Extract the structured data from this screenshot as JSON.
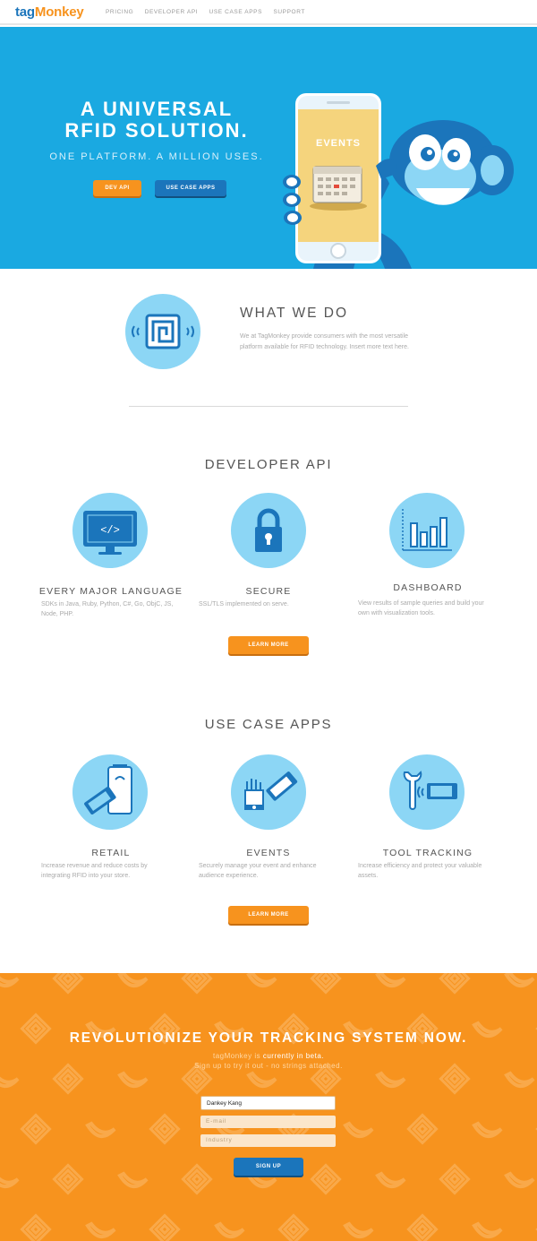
{
  "nav": {
    "logo_tag": "tag",
    "logo_monkey": "Monkey",
    "links": [
      "PRICING",
      "DEVELOPER API",
      "USE CASE APPS",
      "SUPPORT"
    ]
  },
  "hero": {
    "title_line1": "A UNIVERSAL",
    "title_line2": "RFID SOLUTION.",
    "subtitle": "ONE PLATFORM. A MILLION USES.",
    "btn_dev": "DEV API",
    "btn_use_case": "USE CASE APPS",
    "phone_label": "EVENTS"
  },
  "what": {
    "title": "WHAT WE DO",
    "description": "We at TagMonkey provide consumers with the most versatile platform available for RFID technology. Insert more text here."
  },
  "developer": {
    "title": "DEVELOPER API",
    "features": [
      {
        "title": "EVERY MAJOR LANGUAGE",
        "desc": "SDKs in Java, Ruby, Python, C#, Go, ObjC, JS, Node, PHP."
      },
      {
        "title": "SECURE",
        "desc": "SSL/TLS implemented on serve."
      },
      {
        "title": "DASHBOARD",
        "desc": "View results of sample queries and build your own with visualization tools."
      }
    ],
    "button": "LEARN MORE"
  },
  "usecases": {
    "title": "USE CASE APPS",
    "features": [
      {
        "title": "RETAIL",
        "desc": "Increase revenue and reduce costs by integrating RFID into your store."
      },
      {
        "title": "EVENTS",
        "desc": "Securely manage your event and enhance audience experience."
      },
      {
        "title": "TOOL TRACKING",
        "desc": "Increase efficiency and protect your valuable assets."
      }
    ],
    "button": "LEARN MORE"
  },
  "signup": {
    "title": "REVOLUTIONIZE YOUR TRACKING SYSTEM NOW.",
    "line1_pre": "tagMonkey is ",
    "line1_bold": "currently in beta.",
    "line2": "Sign up to try it out - no strings attached.",
    "name_value": "Dankey Kang",
    "email_placeholder": "E-mail",
    "industry_placeholder": "Industry",
    "button": "SIGN UP"
  },
  "colors": {
    "brand_blue": "#1b75bb",
    "brand_orange": "#f7931e",
    "hero_blue": "#1aa9e1",
    "circle_blue": "#8cd6f5"
  }
}
